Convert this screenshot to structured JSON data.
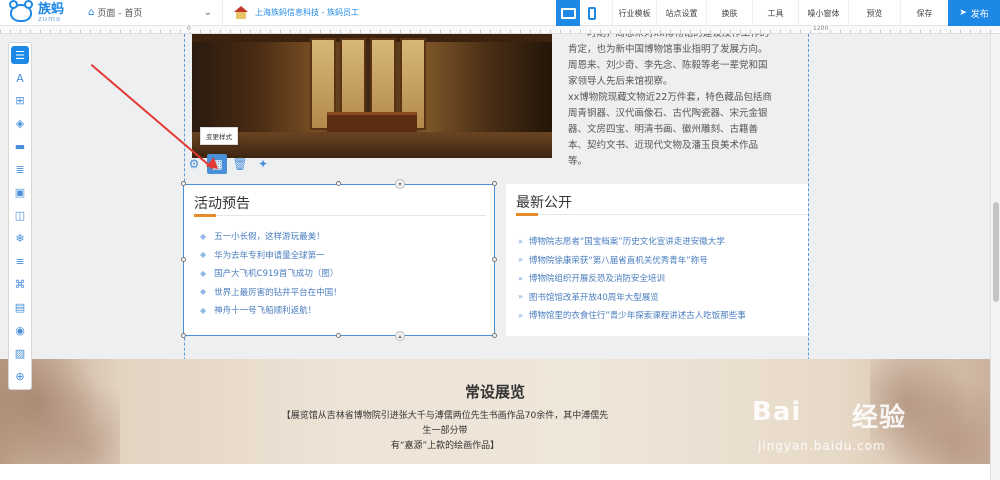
{
  "app": {
    "logo_cn": "族蚂",
    "logo_en": "zuma",
    "page_select_label": "页面 - 首页",
    "site_name": "上海族蚂信息科技 - 族蚂员工",
    "menu": [
      "行业模板",
      "站点设置",
      "换肤",
      "工具",
      "噪小窗体",
      "预览",
      "保存"
    ],
    "publish_label": "发布",
    "ruler_labels": [
      "0",
      "1200"
    ]
  },
  "editor": {
    "tooltip": "变更样式",
    "float_tools": [
      "gear-icon",
      "grid-style-icon",
      "trash-icon",
      "magic-wand-icon"
    ],
    "left_tools": [
      "list-icon",
      "text-icon",
      "image-text-icon",
      "shapes-icon",
      "divider-icon",
      "bullet-list-icon",
      "gallery-icon",
      "bag-icon",
      "snowflake-icon",
      "form-icon",
      "camera-icon",
      "article-icon",
      "video-icon",
      "picture-icon",
      "search-zoom-icon"
    ]
  },
  "content": {
    "intro_lines": [
      "一一时期，周恩来对xx博物馆的建设及作工作的",
      "肯定，也为新中国博物馆事业指明了发展方向。",
      "周恩来、刘少奇、李先念、陈毅等老一辈党和国",
      "家领导人先后来馆视察。",
      "xx博物院现藏文物近22万件套，特色藏品包括商",
      "周青铜器、汉代画像石、古代陶瓷器、宋元金银",
      "器、文房四宝、明清书画、徽州雕刻、古籍善",
      "本、契约文书、近现代文物及潘玉良美术作品",
      "等。"
    ],
    "events": {
      "title": "活动预告",
      "items": [
        "五一小长假，这样游玩最美！",
        "华为去年专利申请量全球第一",
        "国产大飞机C919首飞成功（图）",
        "世界上最厉害的钻井平台在中国！",
        "神舟十一号飞船顺利返航！"
      ]
    },
    "news": {
      "title": "最新公开",
      "items": [
        "博物院志愿者“国宝档案”历史文化宣讲走进安徽大学",
        "博物院徐康荣获“第八届省直机关优秀青年”称号",
        "博物院组织开展反恐及消防安全培训",
        "图书馆馆改革开放40周年大型展览",
        "博物馆里的衣食住行”青少年探索课程讲述古人吃饭那些事"
      ]
    },
    "exhibit": {
      "title": "常设展览",
      "desc_line1": "【展览馆从吉林省博物院引进张大千与溥儒两位先生书画作品70余件，其中溥儒先生一部分带",
      "desc_line2": "有“嘉源”上款的绘画作品】"
    },
    "watermark": {
      "main": "Bai",
      "main2": "经验",
      "sub": "jingyan.baidu.com"
    }
  },
  "colors": {
    "accent": "#1e88e5",
    "orange_accent": "#e68b2b",
    "link": "#4a7dbf",
    "arrow": "#e53935"
  }
}
